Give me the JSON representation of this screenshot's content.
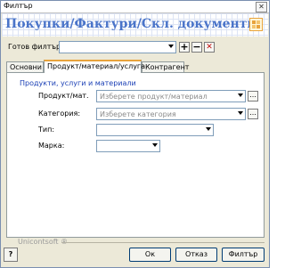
{
  "window": {
    "title": "Филтър",
    "close_symbol": "✕"
  },
  "banner": {
    "heading": "Покупки/Фактури/Скл. документи"
  },
  "ready_filter": {
    "label": "Готов филтър:",
    "value": "",
    "add_symbol": "+",
    "remove_symbol": "−",
    "clear_symbol": "✕"
  },
  "tabs": [
    {
      "label": "Основни"
    },
    {
      "label": "Продукт/материал/услуга"
    },
    {
      "label": "Контрагент"
    }
  ],
  "panel": {
    "section_title": "Продукти, услуги и материали",
    "product": {
      "label": "Продукт/мат.",
      "placeholder": "Изберете продукт/материал",
      "browse": "..."
    },
    "category": {
      "label": "Категория:",
      "placeholder": "Изберете категория",
      "browse": "..."
    },
    "type": {
      "label": "Тип:",
      "value": ""
    },
    "brand": {
      "label": "Марка:",
      "value": ""
    }
  },
  "footer": {
    "brand_text": "Unicontsoft ®",
    "help_symbol": "?",
    "ok": "Ок",
    "cancel": "Отказ",
    "filter": "Филтър"
  },
  "colors": {
    "accent": "#4a74c9",
    "tab_highlight": "#e8a33c",
    "section": "#1a3fb5"
  }
}
